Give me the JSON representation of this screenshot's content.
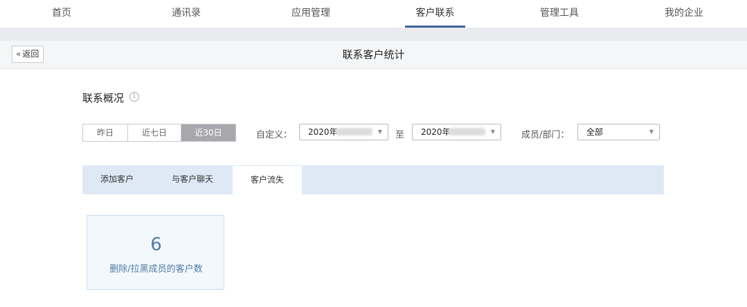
{
  "topnav": {
    "items": [
      "首页",
      "通讯录",
      "应用管理",
      "客户联系",
      "管理工具",
      "我的企业"
    ],
    "active_index": 3
  },
  "titlebar": {
    "back_label": "返回",
    "title": "联系客户统计"
  },
  "overview": {
    "title": "联系概况",
    "info_icon": "info-icon"
  },
  "range": {
    "options": [
      "昨日",
      "近七日",
      "近30日"
    ],
    "active_index": 2
  },
  "filters": {
    "custom_label": "自定义：",
    "start_date": "2020年",
    "to_label": "至",
    "end_date": "2020年",
    "member_label": "成员/部门：",
    "member_value": "全部"
  },
  "tabs": {
    "items": [
      "添加客户",
      "与客户聊天",
      "客户流失"
    ],
    "active_index": 2
  },
  "stat": {
    "value": "6",
    "label": "删除/拉黑成员的客户数"
  },
  "colors": {
    "accent": "#3a6499",
    "stat_text": "#4f7ba7",
    "tab_bar": "#dfe9f5",
    "active_segment": "#a7a8ab"
  }
}
